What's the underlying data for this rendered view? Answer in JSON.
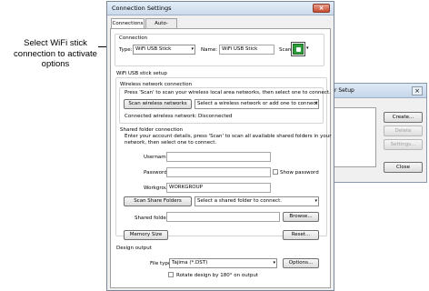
{
  "annotation": {
    "text": "Select WiFi stick connection to activate options"
  },
  "background_dialog": {
    "title_fragment": "r Setup",
    "close_label": "×",
    "buttons": {
      "create": "Create...",
      "delete": "Delete",
      "settings": "Settings...",
      "close": "Close"
    }
  },
  "dialog": {
    "title": "Connection Settings",
    "close_label": "×",
    "tabs": [
      "Connections",
      "Auto-names"
    ],
    "connection": {
      "group_title": "Connection",
      "type_label": "Type:",
      "type_value": "WiFi USB Stick",
      "name_label": "Name:",
      "name_value": "WiFi USB Stick",
      "scan_label": "Scan:"
    },
    "wifi": {
      "section_title": "WiFi USB stick setup",
      "wireless_title": "Wireless network connection",
      "wireless_instructions": "Press 'Scan' to scan your wireless local area networks, then select one to connect.",
      "scan_networks_button": "Scan wireless networks",
      "network_combo": "Select a wireless network or add one to connect",
      "connected_label": "Connected wireless network:",
      "connected_value": "Disconnected",
      "shared_title": "Shared folder connection",
      "shared_instructions_1": "Enter your account details, press 'Scan' to scan all available shared folders in your",
      "shared_instructions_2": "network, then select one to connect.",
      "username_label": "Username:",
      "username_value": "",
      "password_label": "Password:",
      "password_value": "",
      "show_password_label": "Show password",
      "workgroup_label": "Workgroup:",
      "workgroup_value": "WORKGROUP",
      "scan_folders_button": "Scan Share Folders",
      "folder_combo": "Select a shared folder to connect.",
      "shared_folder_label": "Shared folder:",
      "shared_folder_value": "",
      "browse_button": "Browse...",
      "memory_button": "Memory Size",
      "reset_button": "Reset..."
    },
    "design": {
      "section_title": "Design output",
      "file_type_label": "File type:",
      "file_type_value": "Tajima (*.DST)",
      "options_button": "Options...",
      "rotate_label": "Rotate design by 180° on output"
    },
    "dropdown_glyph": "▾"
  }
}
